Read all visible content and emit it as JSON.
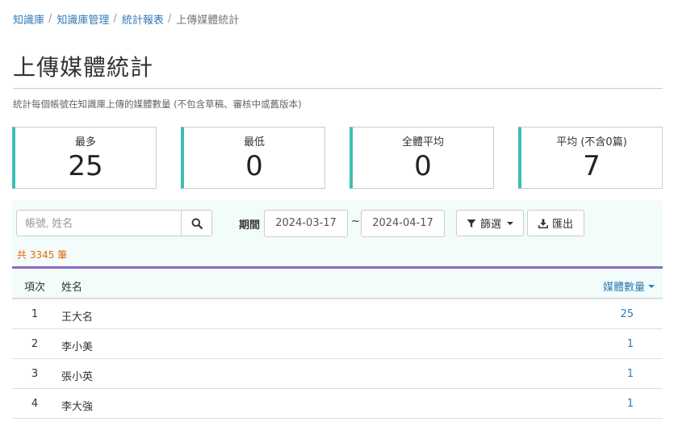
{
  "breadcrumb": [
    {
      "label": "知識庫"
    },
    {
      "label": "知識庫管理"
    },
    {
      "label": "統計報表"
    }
  ],
  "breadcrumb_current": "上傳媒體統計",
  "page": {
    "title": "上傳媒體統計",
    "subtitle": "統計每個帳號在知識庫上傳的媒體數量 (不包含草稿、審核中或舊版本)"
  },
  "stats": [
    {
      "label": "最多",
      "value": "25"
    },
    {
      "label": "最低",
      "value": "0"
    },
    {
      "label": "全體平均",
      "value": "0"
    },
    {
      "label": "平均 (不含0篇)",
      "value": "7"
    }
  ],
  "filters": {
    "search_placeholder": "帳號, 姓名",
    "search_icon": "search-icon",
    "period_label": "期間",
    "date_from": "2024-03-17",
    "date_separator": "~",
    "date_to": "2024-04-17",
    "filter_label": "篩選",
    "filter_icon": "filter-icon",
    "export_label": "匯出",
    "export_icon": "download-icon",
    "result_count": "共 3345 筆"
  },
  "table": {
    "headers": {
      "index": "項次",
      "name": "姓名",
      "count": "媒體數量"
    },
    "sort_icon": "caret-down-icon",
    "rows": [
      {
        "index": "1",
        "name": "王大名",
        "count": "25"
      },
      {
        "index": "2",
        "name": "李小美",
        "count": "1"
      },
      {
        "index": "3",
        "name": "張小英",
        "count": "1"
      },
      {
        "index": "4",
        "name": "李大強",
        "count": "1"
      }
    ]
  },
  "colors": {
    "accent_teal": "#3dbdb6",
    "header_purple": "#8a6bbf",
    "link_blue": "#337ab7",
    "count_orange": "#e8660c",
    "panel_bg": "#f2fcfa"
  }
}
